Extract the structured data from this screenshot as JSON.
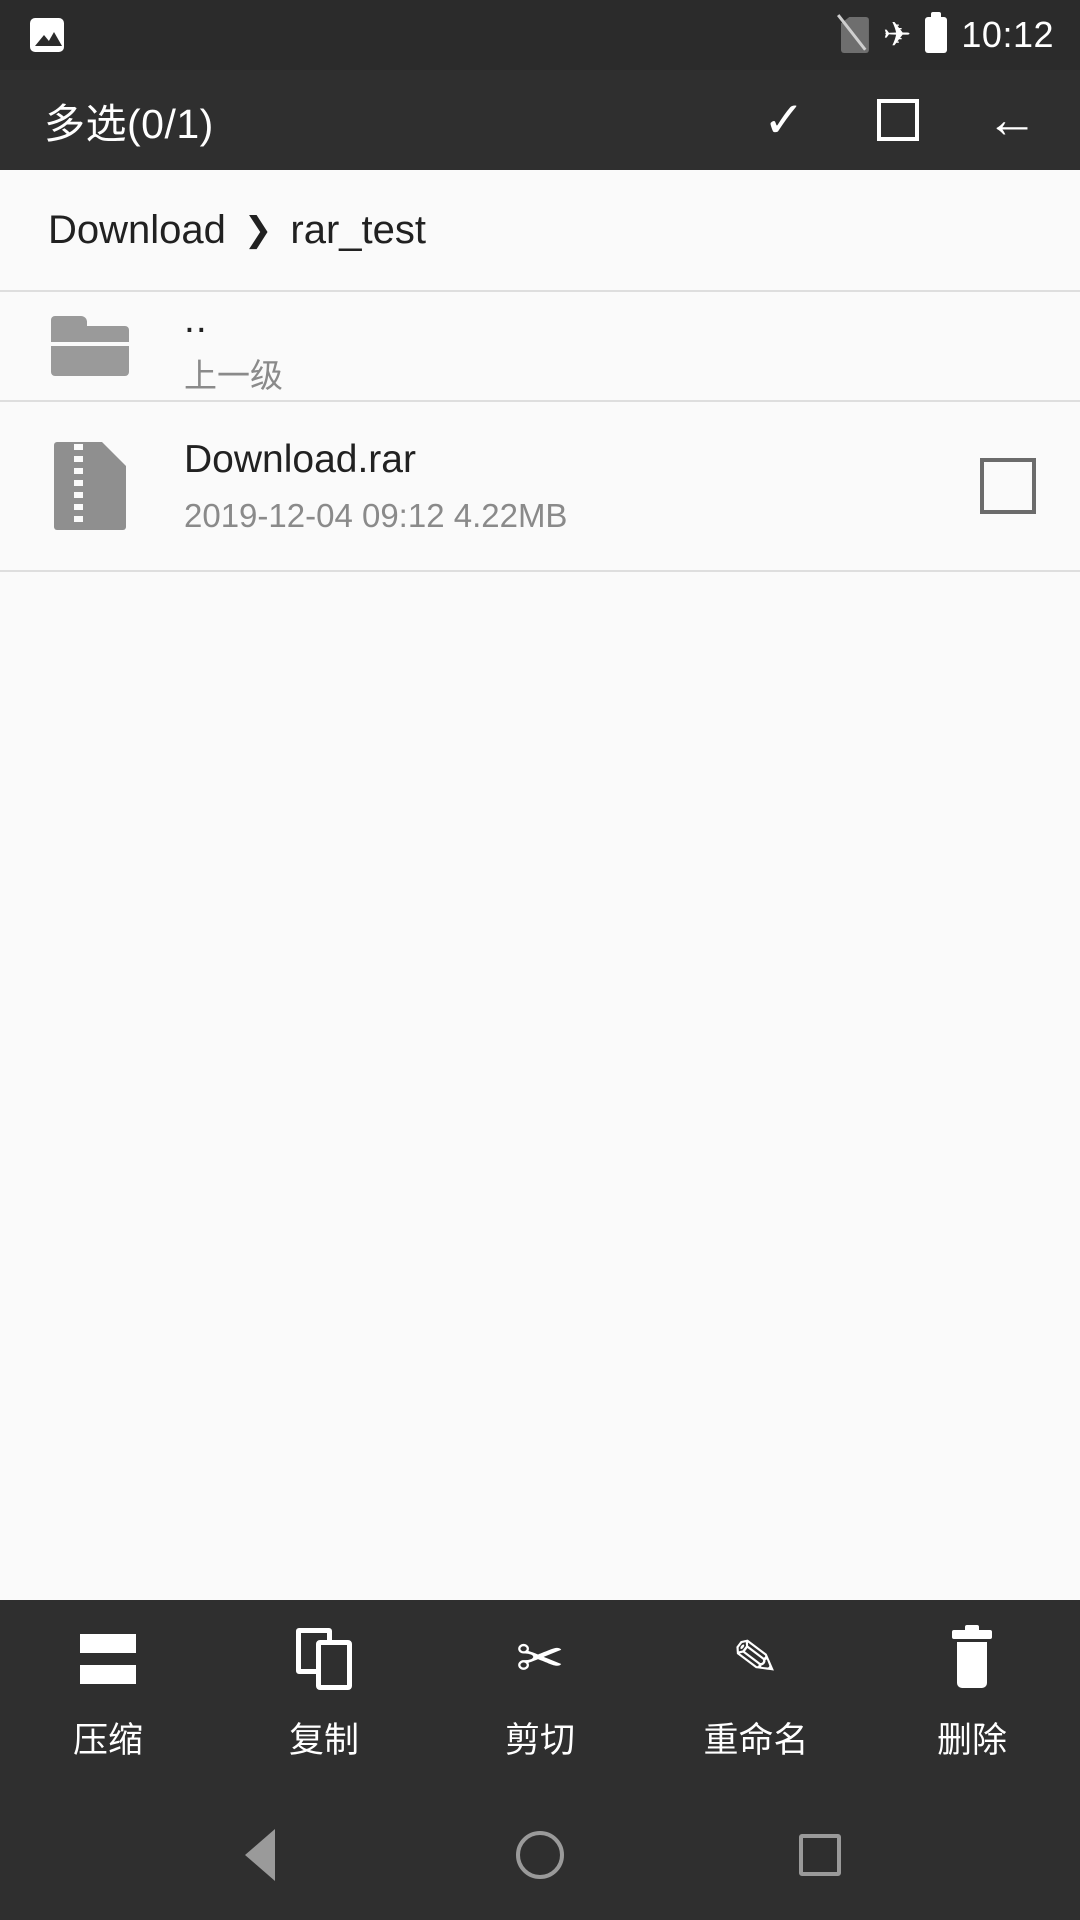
{
  "status_bar": {
    "notification_icon": "image-notification-icon",
    "signal_icon": "no-sim-icon",
    "airplane_icon": "airplane-mode-icon",
    "battery_icon": "battery-full-icon",
    "time": "10:12"
  },
  "app_bar": {
    "title": "多选(0/1)",
    "actions": [
      {
        "name": "confirm-selection",
        "icon": "check-icon",
        "glyph": "✓"
      },
      {
        "name": "select-all",
        "icon": "square-icon"
      },
      {
        "name": "back",
        "icon": "arrow-left-icon",
        "glyph": "←"
      }
    ]
  },
  "breadcrumb": {
    "segments": [
      "Download",
      "rar_test"
    ],
    "separator": "❯"
  },
  "file_list": {
    "items": [
      {
        "icon": "folder-icon",
        "title": "..",
        "subtitle": "上一级",
        "checkbox": false
      },
      {
        "icon": "archive-rar-icon",
        "title": "Download.rar",
        "subtitle": "2019-12-04 09:12  4.22MB",
        "checkbox": true,
        "checked": false
      }
    ]
  },
  "bottom_bar": {
    "items": [
      {
        "label": "压缩",
        "icon": "compress-icon"
      },
      {
        "label": "复制",
        "icon": "copy-icon"
      },
      {
        "label": "剪切",
        "icon": "scissors-icon",
        "glyph": "✂"
      },
      {
        "label": "重命名",
        "icon": "pencil-icon",
        "glyph": "✎"
      },
      {
        "label": "删除",
        "icon": "trash-icon"
      }
    ]
  },
  "nav_bar": {
    "back": "nav-back-icon",
    "home": "nav-home-icon",
    "recents": "nav-recents-icon"
  },
  "colors": {
    "status_bar_bg": "#2b2b2b",
    "app_bar_bg": "#2f2f2f",
    "page_bg": "#fafafa",
    "divider": "#dedede",
    "primary_text": "#212121",
    "secondary_text": "#8a8a8a",
    "icon_gray": "#9a9a9a"
  }
}
